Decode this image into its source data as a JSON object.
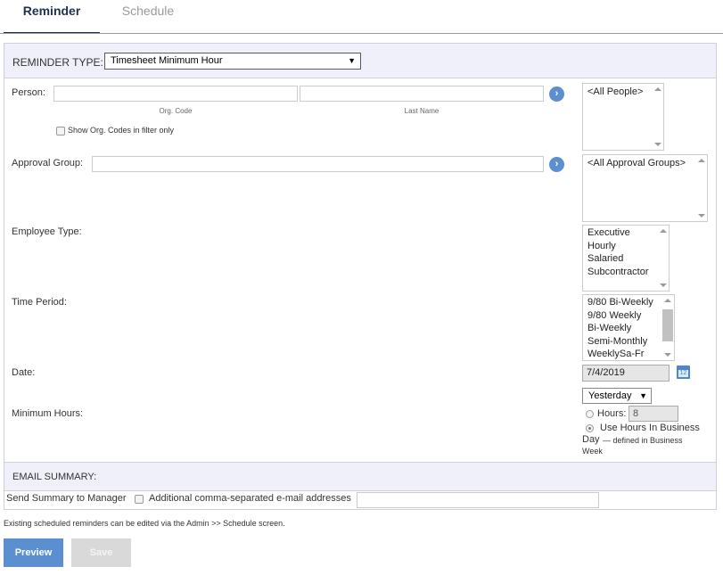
{
  "tabs": {
    "reminder": "Reminder",
    "schedule": "Schedule"
  },
  "reminder_type": {
    "label": "REMINDER TYPE:",
    "value": "Timesheet Minimum Hour"
  },
  "person": {
    "label": "Person:",
    "org_code_value": "",
    "last_name_value": "",
    "org_code_caption": "Org. Code",
    "last_name_caption": "Last Name",
    "show_org_codes_label": "Show Org. Codes in filter only",
    "list": [
      "<All People>"
    ]
  },
  "approval_group": {
    "label": "Approval Group:",
    "value": "",
    "list": [
      "<All Approval Groups>"
    ]
  },
  "employee_type": {
    "label": "Employee Type:",
    "options": [
      "Executive",
      "Hourly",
      "Salaried",
      "Subcontractor"
    ]
  },
  "time_period": {
    "label": "Time Period:",
    "options": [
      "9/80 Bi-Weekly",
      "9/80 Weekly",
      "Bi-Weekly",
      "Semi-Monthly",
      "WeeklySa-Fr"
    ]
  },
  "date": {
    "label": "Date:",
    "value": "7/4/2019",
    "relative": "Yesterday"
  },
  "minimum_hours": {
    "label": "Minimum Hours:",
    "hours_label": "Hours:",
    "hours_value": "8",
    "use_business_day_main": "Use Hours In Business",
    "use_business_day_day": "Day",
    "use_business_day_note1": "— defined in Business",
    "use_business_day_note2": "Week"
  },
  "email_summary": {
    "label": "EMAIL SUMMARY:",
    "send_to_manager": "Send Summary to Manager",
    "additional_label": "Additional comma-separated e-mail addresses",
    "additional_value": ""
  },
  "footer_note": "Existing scheduled reminders can be edited via the Admin >> Schedule screen.",
  "buttons": {
    "preview": "Preview",
    "save": "Save"
  },
  "colors": {
    "accent": "#5b8fd0",
    "header_band": "#f0f0fb",
    "tab_active": "#1f3150",
    "button_disabled": "#d9d9d9"
  }
}
